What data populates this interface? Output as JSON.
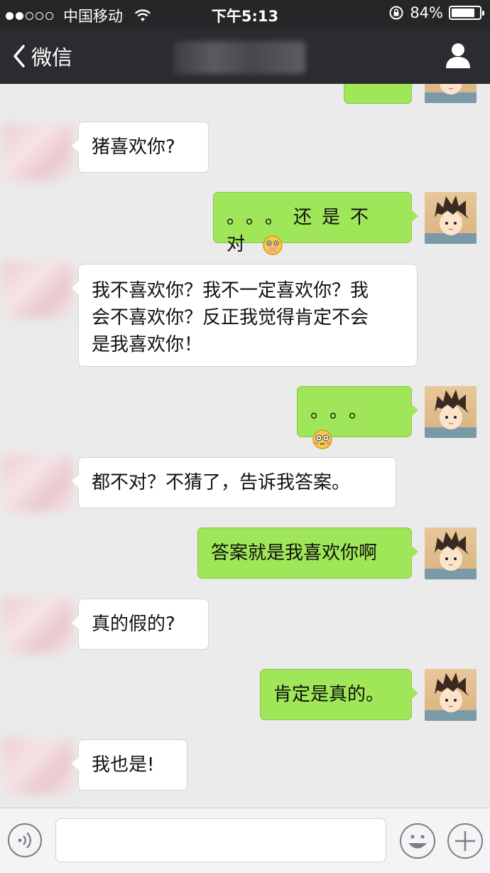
{
  "status_bar": {
    "carrier": "中国移动",
    "time": "下午5:13",
    "battery_text": "84%",
    "battery_level": 0.84
  },
  "nav": {
    "back_label": "微信"
  },
  "messages": [
    {
      "side": "out",
      "text": "……",
      "partial": true
    },
    {
      "side": "in",
      "text": "猪喜欢你?"
    },
    {
      "side": "out",
      "text": "。。。还是不对",
      "emoji": "silent-face"
    },
    {
      "side": "in",
      "lines": [
        "我不喜欢你？我不一定喜欢你？我",
        "会不喜欢你？反正我觉得肯定不会",
        "是我喜欢你！"
      ]
    },
    {
      "side": "out",
      "text": "。。。",
      "emoji": "flushed-face"
    },
    {
      "side": "in",
      "text": "都不对？不猜了，告诉我答案。"
    },
    {
      "side": "out",
      "text": "答案就是我喜欢你啊"
    },
    {
      "side": "in",
      "text": "真的假的?"
    },
    {
      "side": "out",
      "text": "肯定是真的。"
    },
    {
      "side": "in",
      "text": "我也是!"
    }
  ],
  "colors": {
    "nav_bg": "#2b2c2f",
    "chat_bg": "#ebebeb",
    "out_bubble": "#9fe658",
    "in_bubble": "#ffffff"
  }
}
